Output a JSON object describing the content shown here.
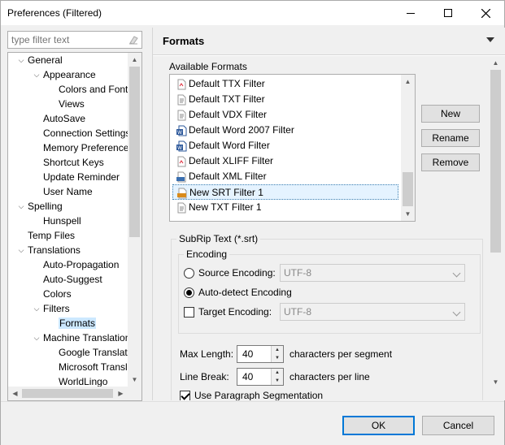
{
  "window": {
    "title": "Preferences (Filtered)"
  },
  "filter": {
    "placeholder": "type filter text"
  },
  "tree": [
    {
      "label": "General",
      "level": 0,
      "twisty": "open"
    },
    {
      "label": "Appearance",
      "level": 1,
      "twisty": "open"
    },
    {
      "label": "Colors and Fonts",
      "level": 2,
      "twisty": ""
    },
    {
      "label": "Views",
      "level": 2,
      "twisty": ""
    },
    {
      "label": "AutoSave",
      "level": 1,
      "twisty": ""
    },
    {
      "label": "Connection Settings",
      "level": 1,
      "twisty": ""
    },
    {
      "label": "Memory Preferences",
      "level": 1,
      "twisty": ""
    },
    {
      "label": "Shortcut Keys",
      "level": 1,
      "twisty": ""
    },
    {
      "label": "Update Reminder",
      "level": 1,
      "twisty": ""
    },
    {
      "label": "User Name",
      "level": 1,
      "twisty": ""
    },
    {
      "label": "Spelling",
      "level": 0,
      "twisty": "open"
    },
    {
      "label": "Hunspell",
      "level": 1,
      "twisty": ""
    },
    {
      "label": "Temp Files",
      "level": 0,
      "twisty": ""
    },
    {
      "label": "Translations",
      "level": 0,
      "twisty": "open"
    },
    {
      "label": "Auto-Propagation",
      "level": 1,
      "twisty": ""
    },
    {
      "label": "Auto-Suggest",
      "level": 1,
      "twisty": ""
    },
    {
      "label": "Colors",
      "level": 1,
      "twisty": ""
    },
    {
      "label": "Filters",
      "level": 1,
      "twisty": "open"
    },
    {
      "label": "Formats",
      "level": 2,
      "twisty": "",
      "selected": true
    },
    {
      "label": "Machine Translation",
      "level": 1,
      "twisty": "open"
    },
    {
      "label": "Google Translate",
      "level": 2,
      "twisty": ""
    },
    {
      "label": "Microsoft Translator",
      "level": 2,
      "twisty": ""
    },
    {
      "label": "WorldLingo",
      "level": 2,
      "twisty": ""
    }
  ],
  "page": {
    "title": "Formats"
  },
  "formats": {
    "label": "Available Formats",
    "items": [
      {
        "label": "Default TTX Filter",
        "icon": "ttx-file-icon"
      },
      {
        "label": "Default TXT Filter",
        "icon": "txt-file-icon"
      },
      {
        "label": "Default VDX Filter",
        "icon": "vdx-file-icon"
      },
      {
        "label": "Default Word 2007 Filter",
        "icon": "word-file-icon"
      },
      {
        "label": "Default Word Filter",
        "icon": "word-file-icon"
      },
      {
        "label": "Default XLIFF Filter",
        "icon": "xliff-file-icon"
      },
      {
        "label": "Default XML Filter",
        "icon": "xml-file-icon"
      },
      {
        "label": "New SRT Filter 1",
        "icon": "srt-file-icon",
        "selected": true
      },
      {
        "label": "New TXT Filter 1",
        "icon": "txt-file-icon"
      }
    ],
    "buttons": {
      "new": "New",
      "rename": "Rename",
      "remove": "Remove"
    }
  },
  "srt": {
    "group_label": "SubRip Text (*.srt)",
    "encoding": {
      "group_label": "Encoding",
      "source_label": "Source Encoding:",
      "source_value": "UTF-8",
      "auto_label": "Auto-detect Encoding",
      "target_label": "Target Encoding:",
      "target_value": "UTF-8",
      "selected": "auto",
      "target_checked": false
    },
    "max_length_label": "Max Length:",
    "max_length_value": "40",
    "max_length_unit": "characters per segment",
    "line_break_label": "Line Break:",
    "line_break_value": "40",
    "line_break_unit": "characters per line",
    "paragraph_label": "Use Paragraph Segmentation",
    "paragraph_checked": true
  },
  "footer": {
    "ok": "OK",
    "cancel": "Cancel"
  }
}
